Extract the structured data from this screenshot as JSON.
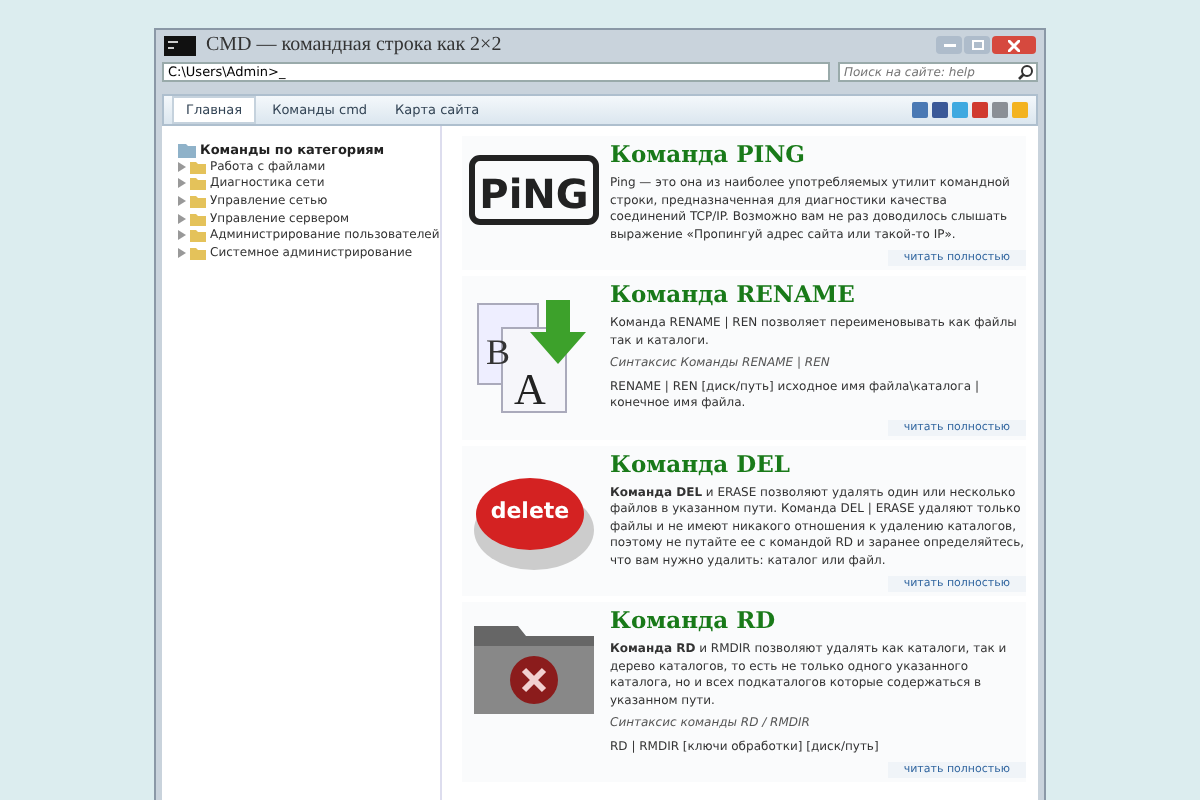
{
  "window": {
    "title": "CMD — командная строка как 2×2"
  },
  "address_bar": {
    "value": "C:\\Users\\Admin>_"
  },
  "search": {
    "placeholder": "Поиск на сайте: help"
  },
  "nav": [
    {
      "label": "Главная",
      "selected": true
    },
    {
      "label": "Команды cmd",
      "selected": false
    },
    {
      "label": "Карта сайта",
      "selected": false
    }
  ],
  "sidebar": {
    "title": "Команды по категориям",
    "items": [
      {
        "label": "Работа с файлами"
      },
      {
        "label": "Диагностика сети"
      },
      {
        "label": "Управление сетью"
      },
      {
        "label": "Управление сервером"
      },
      {
        "label": "Администрирование пользователей"
      },
      {
        "label": "Системное администрирование"
      }
    ]
  },
  "articles": [
    {
      "kind": "ping",
      "image_text": "PiNG",
      "title": "Команда PING",
      "paragraphs": [
        {
          "kind": "text",
          "text": "Ping — это она из наиболее употребляемых утилит командной строки, предназначенная для диагностики качества соединений TCP/IP. Возможно вам не раз доводилось слышать выражение «Пропингуй адрес сайта или такой-то IP»."
        }
      ],
      "read_more": "читать полностью"
    },
    {
      "kind": "rename",
      "image_letters": [
        "B",
        "A"
      ],
      "title": "Команда RENAME",
      "paragraphs": [
        {
          "kind": "text",
          "text": "Команда RENAME | REN позволяет переименовывать как файлы так и каталоги."
        },
        {
          "kind": "syntax",
          "text": "Синтаксис Команды RENAME | REN"
        },
        {
          "kind": "text",
          "text": "RENAME | REN [диск/путь] исходное имя файла\\каталога | конечное имя файла."
        }
      ],
      "read_more": "читать полностью"
    },
    {
      "kind": "delete",
      "image_text": "delete",
      "title": "Команда DEL",
      "paragraphs": [
        {
          "kind": "text",
          "text": "**Команда DEL** и ERASE позволяют удалять один или несколько файлов в указанном пути. Команда DEL | ERASE удаляют только файлы и не имеют никакого отношения к удалению каталогов, поэтому не путайте ее с командой RD и заранее определяйтесь, что вам нужно удалить: каталог или файл."
        }
      ],
      "read_more": "читать полностью"
    },
    {
      "kind": "folder",
      "title": "Команда RD",
      "paragraphs": [
        {
          "kind": "text",
          "text": "**Команда RD** и RMDIR позволяют удалять как каталоги, так и дерево каталогов, то есть не только одного указанного каталога, но и всех подкаталогов которые содержаться в указанном пути."
        },
        {
          "kind": "syntax",
          "text": "Синтаксис команды RD / RMDIR"
        },
        {
          "kind": "text",
          "text": "RD | RMDIR [ключи обработки] [диск/путь]"
        }
      ],
      "read_more": "читать полностью"
    }
  ]
}
